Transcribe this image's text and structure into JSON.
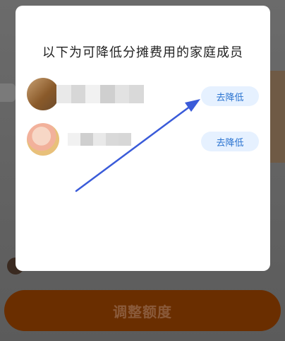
{
  "modal": {
    "title": "以下为可降低分摊费用的家庭成员",
    "members": [
      {
        "button_label": "去降低"
      },
      {
        "button_label": "去降低"
      }
    ]
  },
  "background": {
    "primary_button_label": "调整额度"
  },
  "colors": {
    "overlay": "#5a5a5a",
    "primary_button": "#6a2e00",
    "reduce_button_bg": "#e6f1ff",
    "reduce_button_text": "#2a73d0",
    "annotation_arrow": "#3a5bd9"
  }
}
